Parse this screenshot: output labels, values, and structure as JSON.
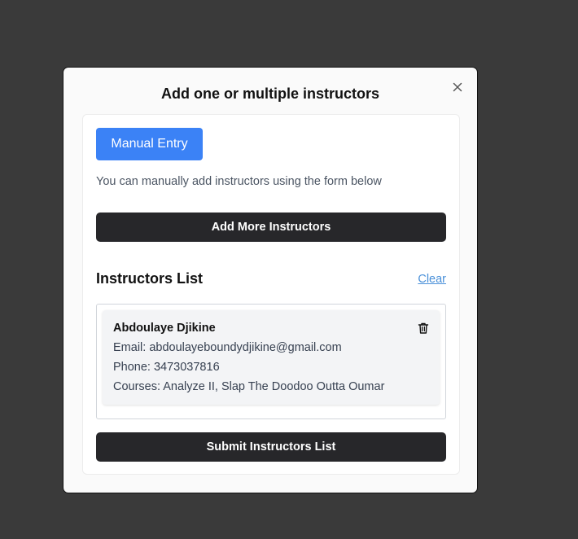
{
  "modal": {
    "title": "Add one or multiple instructors",
    "close_icon": "close-icon"
  },
  "entry": {
    "manual_tab_label": "Manual Entry",
    "hint": "You can manually add instructors using the form below",
    "add_more_label": "Add More Instructors"
  },
  "list": {
    "heading": "Instructors List",
    "clear_label": "Clear",
    "items": [
      {
        "name": "Abdoulaye Djikine",
        "email": "Email: abdoulayeboundydjikine@gmail.com",
        "phone": "Phone: 3473037816",
        "courses": "Courses: Analyze II, Slap The Doodoo Outta Oumar",
        "delete_icon": "trash-icon"
      }
    ],
    "submit_label": "Submit Instructors List"
  },
  "colors": {
    "backdrop": "#3a3a3a",
    "primary_blue": "#3b82f6",
    "dark_button": "#27272a",
    "link": "#4a90d9"
  }
}
